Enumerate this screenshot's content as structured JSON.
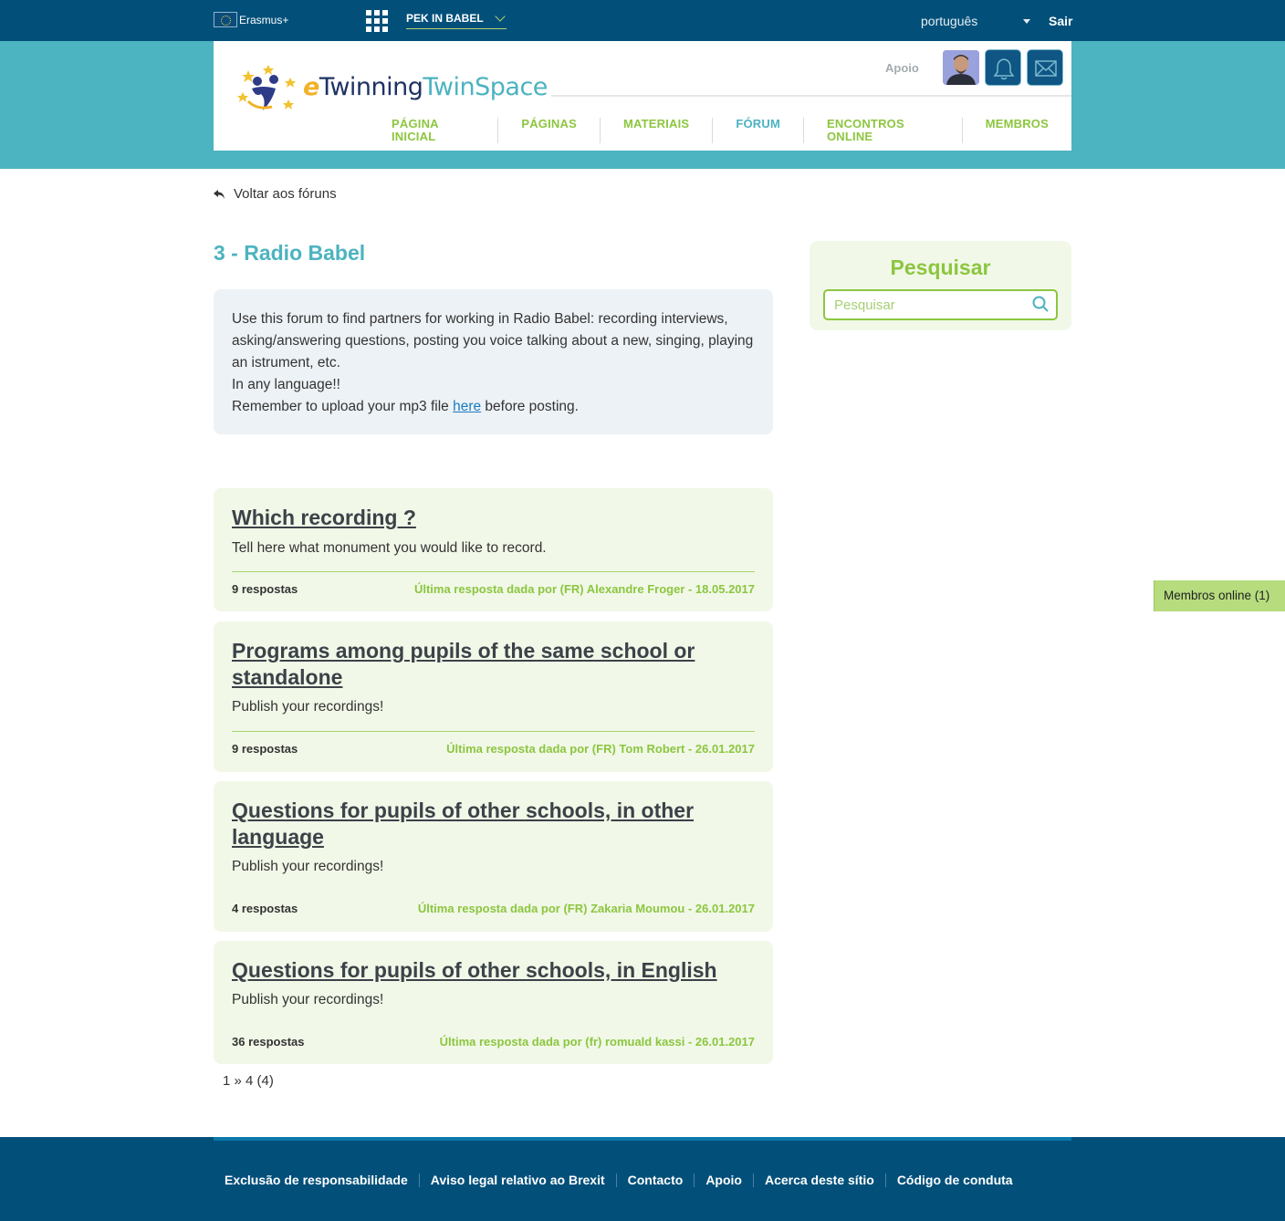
{
  "topbar": {
    "programme": "Erasmus+",
    "project": "PEK IN BABEL",
    "language": "português",
    "logout": "Sair"
  },
  "header": {
    "logo": {
      "e": "e",
      "twinning": "Twinning",
      "twinspace": "TwinSpace"
    },
    "support": "Apoio",
    "nav": [
      "PÁGINA INICIAL",
      "PÁGINAS",
      "MATERIAIS",
      "FÓRUM",
      "ENCONTROS ONLINE",
      "MEMBROS"
    ],
    "active_nav": "FÓRUM"
  },
  "back_link": "Voltar aos fóruns",
  "forum": {
    "title": "3 - Radio Babel",
    "description": {
      "line1": "Use this forum to find partners for working in Radio Babel: recording interviews, asking/answering questions, posting you voice talking about a new, singing, playing an istrument, etc.",
      "line2": "In any language!!",
      "line3_before": "Remember to upload your mp3 file ",
      "line3_link": "here",
      "line3_after": " before posting."
    }
  },
  "topics": [
    {
      "title": "Which recording ?",
      "desc": "Tell here what monument you would like to record.",
      "replies": "9 respostas",
      "last": "Última resposta dada por (FR) Alexandre Froger - 18.05.2017"
    },
    {
      "title": "Programs among pupils of the same school or standalone",
      "desc": "Publish your recordings!",
      "replies": "9 respostas",
      "last": "Última resposta dada por (FR) Tom Robert - 26.01.2017"
    },
    {
      "title": "Questions for pupils of other schools, in other language",
      "desc": "Publish your recordings!",
      "replies": "4 respostas",
      "last": "Última resposta dada por (FR) Zakaria Moumou - 26.01.2017"
    },
    {
      "title": "Questions for pupils of other schools, in English",
      "desc": "Publish your recordings!",
      "replies": "36 respostas",
      "last": "Última resposta dada por (fr) romuald kassi - 26.01.2017"
    }
  ],
  "pager": "1 » 4 (4)",
  "search": {
    "title": "Pesquisar",
    "placeholder": "Pesquisar"
  },
  "online_members": "Membros online (1)",
  "footer": [
    "Exclusão de responsabilidade",
    "Aviso legal relativo ao Brexit",
    "Contacto",
    "Apoio",
    "Acerca deste sítio",
    "Código de conduta"
  ],
  "colors": {
    "navy": "#02507a",
    "teal": "#4cb3c0",
    "green": "#8cc63f",
    "light_green_bg": "#f1f8e8"
  }
}
